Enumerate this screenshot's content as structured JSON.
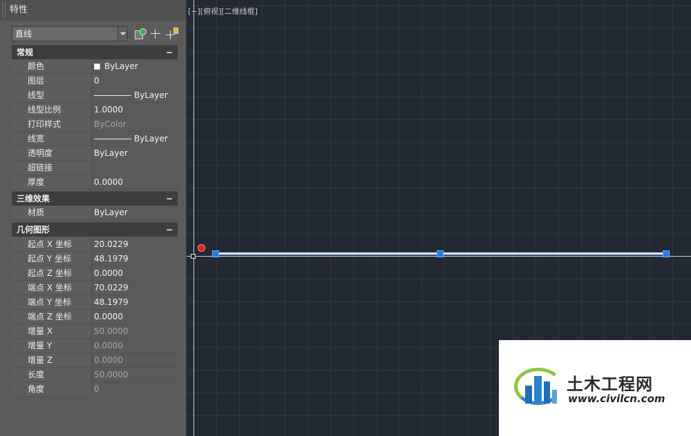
{
  "palette": {
    "title": "特性",
    "object_type": "直线",
    "sections": {
      "general": {
        "title": "常规",
        "collapse_symbol": "−",
        "rows": [
          {
            "label": "颜色",
            "value": "ByLayer"
          },
          {
            "label": "图层",
            "value": "0"
          },
          {
            "label": "线型",
            "value": "ByLayer"
          },
          {
            "label": "线型比例",
            "value": "1.0000"
          },
          {
            "label": "打印样式",
            "value": "ByColor"
          },
          {
            "label": "线宽",
            "value": "ByLayer"
          },
          {
            "label": "透明度",
            "value": "ByLayer"
          },
          {
            "label": "超链接",
            "value": ""
          },
          {
            "label": "厚度",
            "value": "0.0000"
          }
        ]
      },
      "3d": {
        "title": "三维效果",
        "collapse_symbol": "−",
        "rows": [
          {
            "label": "材质",
            "value": "ByLayer"
          }
        ]
      },
      "geometry": {
        "title": "几何图形",
        "collapse_symbol": "−",
        "rows": [
          {
            "label": "起点 X 坐标",
            "value": "20.0229"
          },
          {
            "label": "起点 Y 坐标",
            "value": "48.1979"
          },
          {
            "label": "起点 Z 坐标",
            "value": "0.0000"
          },
          {
            "label": "端点 X 坐标",
            "value": "70.0229"
          },
          {
            "label": "端点 Y 坐标",
            "value": "48.1979"
          },
          {
            "label": "端点 Z 坐标",
            "value": "0.0000"
          },
          {
            "label": "增量 X",
            "value": "50.0000"
          },
          {
            "label": "增量 Y",
            "value": "0.0000"
          },
          {
            "label": "增量 Z",
            "value": "0.0000"
          },
          {
            "label": "长度",
            "value": "50.0000"
          },
          {
            "label": "角度",
            "value": "0"
          }
        ]
      }
    }
  },
  "viewport": {
    "label": "[−][俯视][二维线框]"
  },
  "watermark": {
    "title": "土木工程网",
    "url": "www.civilcn.com"
  },
  "colors": {
    "canvas_bg": "#222933",
    "palette_bg": "#5b5b5b",
    "grip": "#1e7ee0",
    "marker": "#e02020"
  }
}
